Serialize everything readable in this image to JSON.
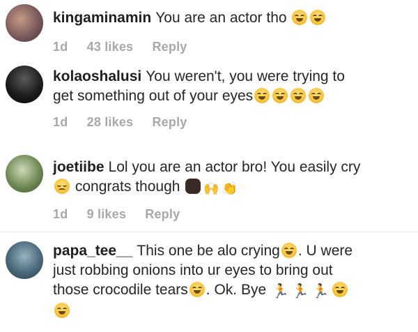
{
  "comments": [
    {
      "username": "kingaminamin",
      "lines": [
        "You are an actor tho"
      ],
      "meta": {
        "time": "1d",
        "likes": "43 likes",
        "reply": "Reply"
      },
      "colors": {
        "avatar": "#7b5a5d"
      }
    },
    {
      "username": "kolaoshalusi",
      "lines": [
        "You weren't, you were trying to",
        "get something out of your eyes"
      ],
      "meta": {
        "time": "1d",
        "likes": "28 likes",
        "reply": "Reply"
      },
      "colors": {
        "avatar": "#1d1d1d"
      }
    },
    {
      "username": "joetiibe",
      "lines": [
        "Lol you are an actor bro! You easily cry",
        "congrats though"
      ],
      "meta": {
        "time": "1d",
        "likes": "9 likes",
        "reply": "Reply"
      },
      "colors": {
        "avatar": "#6f8a55"
      }
    },
    {
      "username": "papa_tee__",
      "lines": [
        "This one be alo crying",
        ". U were",
        "just robbing onions into ur eyes to bring out",
        "those crocodile tears",
        ". Ok. Bye"
      ],
      "colors": {
        "avatar": "#4a6a7c"
      }
    }
  ]
}
